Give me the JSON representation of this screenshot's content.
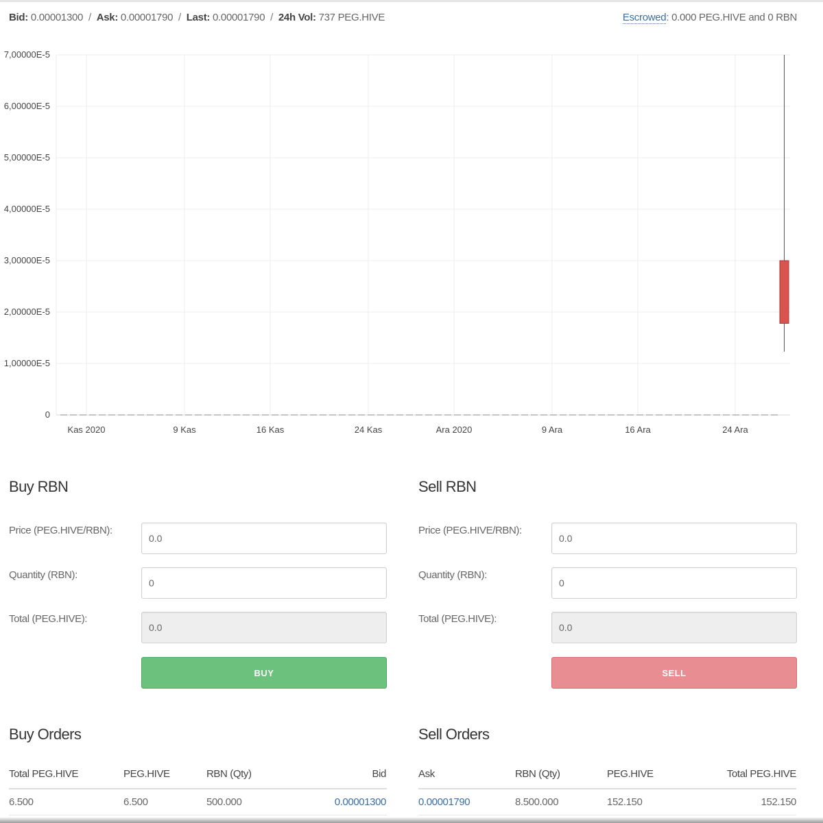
{
  "ticker": {
    "bid_label": "Bid:",
    "bid_value": "0.00001300",
    "ask_label": "Ask:",
    "ask_value": "0.00001790",
    "last_label": "Last:",
    "last_value": "0.00001790",
    "vol_label": "24h Vol:",
    "vol_value": "737 PEG.HIVE",
    "separator": "/"
  },
  "escrow": {
    "link_label": "Escrowed",
    "value": ": 0.000 PEG.HIVE and 0 RBN"
  },
  "chart_data": {
    "type": "candlestick",
    "y_ticks": [
      "0",
      "1,00000E-5",
      "2,00000E-5",
      "3,00000E-5",
      "4,00000E-5",
      "5,00000E-5",
      "6,00000E-5",
      "7,00000E-5"
    ],
    "ylim": [
      0,
      7e-05
    ],
    "x_ticks": [
      "Kas 2020",
      "9 Kas",
      "16 Kas",
      "24 Kas",
      "Ara 2020",
      "9 Ara",
      "16 Ara",
      "24 Ara"
    ],
    "grid": true,
    "candles": [
      {
        "open": 3e-05,
        "close": 1.78e-05,
        "high": 7e-05,
        "low": 1.23e-05,
        "color": "#d9534f"
      }
    ],
    "volume_baseline": 0
  },
  "buy": {
    "title": "Buy RBN",
    "price_label": "Price (PEG.HIVE/RBN):",
    "price_value": "0.0",
    "qty_label": "Quantity (RBN):",
    "qty_value": "0",
    "total_label": "Total (PEG.HIVE):",
    "total_value": "0.0",
    "button": "BUY"
  },
  "sell": {
    "title": "Sell RBN",
    "price_label": "Price (PEG.HIVE/RBN):",
    "price_value": "0.0",
    "qty_label": "Quantity (RBN):",
    "qty_value": "0",
    "total_label": "Total (PEG.HIVE):",
    "total_value": "0.0",
    "button": "SELL"
  },
  "buy_orders": {
    "title": "Buy Orders",
    "columns": [
      "Total PEG.HIVE",
      "PEG.HIVE",
      "RBN (Qty)",
      "Bid"
    ],
    "rows": [
      [
        "6.500",
        "6.500",
        "500.000",
        "0.00001300"
      ]
    ]
  },
  "sell_orders": {
    "title": "Sell Orders",
    "columns": [
      "Ask",
      "RBN (Qty)",
      "PEG.HIVE",
      "Total PEG.HIVE"
    ],
    "rows": [
      [
        "0.00001790",
        "8.500.000",
        "152.150",
        "152.150"
      ]
    ]
  },
  "colors": {
    "buy": "#6cc17c",
    "sell": "#e88e93",
    "candle_down": "#d9534f",
    "link": "#3a6ea5"
  }
}
